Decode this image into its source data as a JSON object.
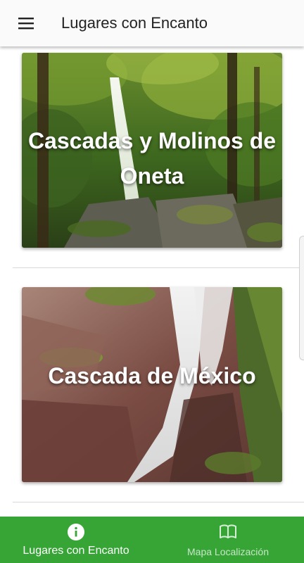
{
  "app_bar": {
    "title": "Lugares con Encanto",
    "menu_icon": "menu-icon"
  },
  "places": [
    {
      "title": "Cascadas y Molinos de Oneta",
      "image": "forest-waterfall-photo"
    },
    {
      "title": "Cascada de México",
      "image": "rocky-waterfall-photo"
    }
  ],
  "bottom_nav": {
    "items": [
      {
        "label": "Lugares con Encanto",
        "icon": "info-icon",
        "active": true
      },
      {
        "label": "Mapa Localización",
        "icon": "map-book-icon",
        "active": false
      }
    ]
  },
  "colors": {
    "app_bar_background": "#fafafa",
    "bottom_nav_background": "#36a536",
    "card_title_text": "#ffffff",
    "divider": "#d9d9d9"
  }
}
